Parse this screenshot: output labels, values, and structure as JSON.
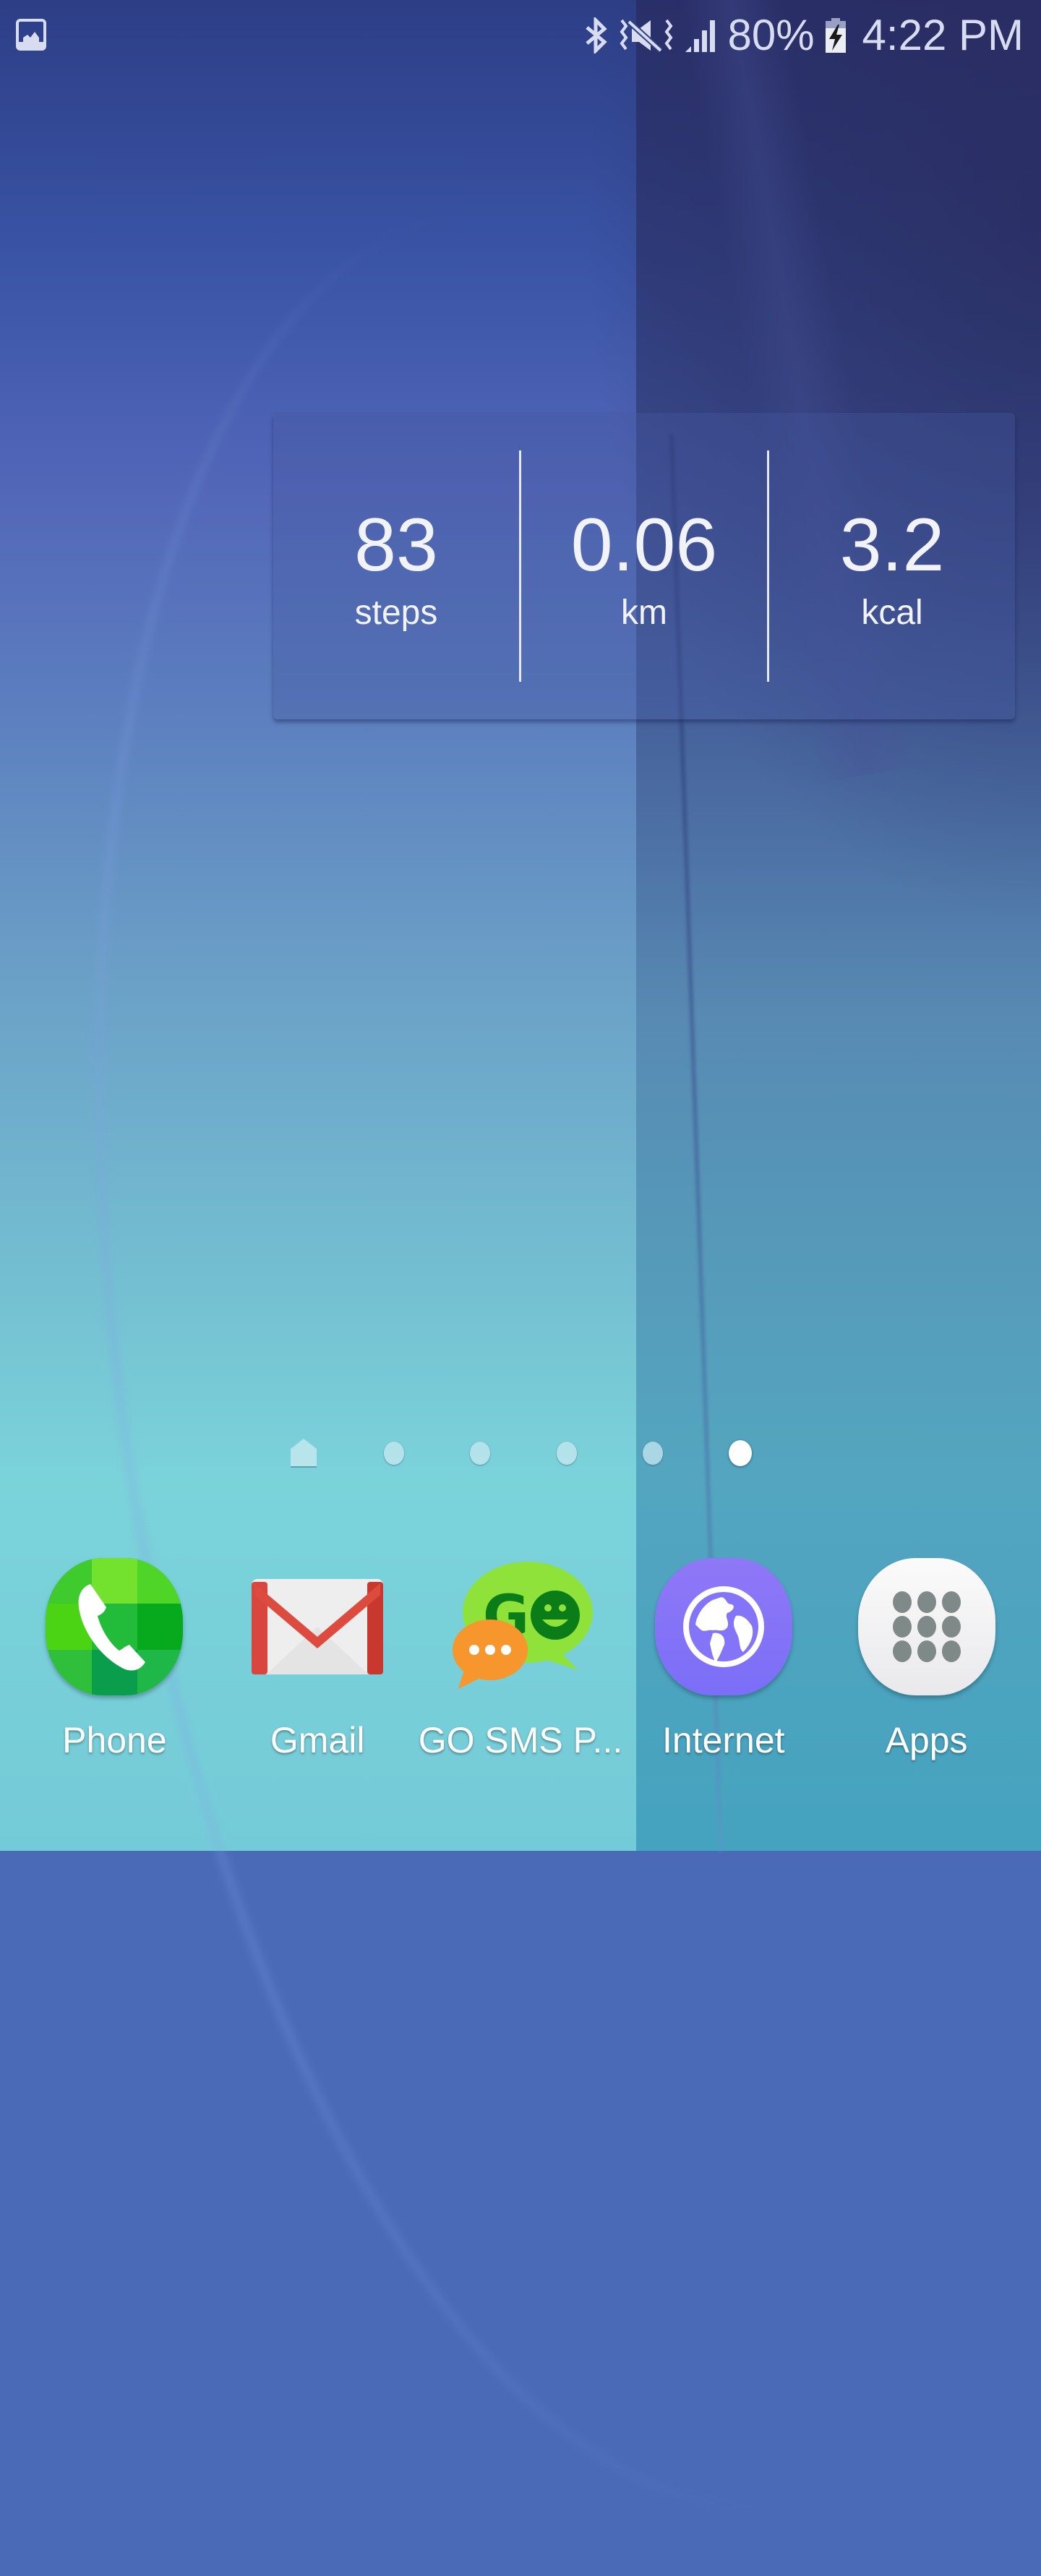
{
  "status_bar": {
    "left_icons": [
      "gallery-icon"
    ],
    "right_icons": [
      "bluetooth-icon",
      "vibrate-mute-icon",
      "signal-icon",
      "battery-charging-icon"
    ],
    "battery_percent": "80%",
    "time": "4:22 PM"
  },
  "pedometer_widget": {
    "stats": [
      {
        "value": "83",
        "unit": "steps"
      },
      {
        "value": "0.06",
        "unit": "km"
      },
      {
        "value": "3.2",
        "unit": "kcal"
      }
    ]
  },
  "page_indicator": {
    "pages": 6,
    "home_page_index": 0,
    "active_page_index": 5
  },
  "dock": {
    "apps": [
      {
        "label": "Phone",
        "icon": "phone-icon",
        "color": "#1fb94a"
      },
      {
        "label": "Gmail",
        "icon": "gmail-icon",
        "color": "#d9463e"
      },
      {
        "label": "GO SMS P...",
        "icon": "go-sms-icon",
        "color": "#8fe23a"
      },
      {
        "label": "Internet",
        "icon": "globe-icon",
        "color": "#8474f7"
      },
      {
        "label": "Apps",
        "icon": "apps-grid-icon",
        "color": "#7f8a88"
      }
    ]
  }
}
